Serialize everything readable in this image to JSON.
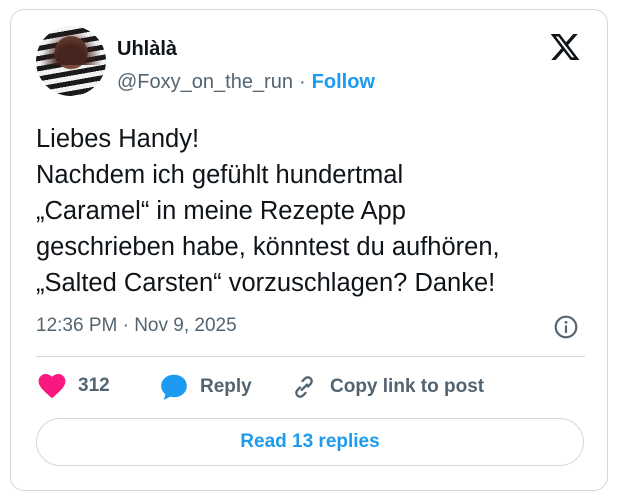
{
  "author": {
    "display_name": "Uhlàlà",
    "handle": "@Foxy_on_the_run",
    "separator": "·",
    "follow_label": "Follow"
  },
  "tweet": {
    "lines": [
      "Liebes Handy!",
      "Nachdem ich gefühlt hundertmal",
      "„Caramel“ in meine Rezepte App",
      "geschrieben habe, könntest du aufhören,",
      "„Salted Carsten“ vorzuschlagen? Danke!"
    ],
    "timestamp": "12:36 PM · Nov 9, 2025"
  },
  "actions": {
    "like_count": "312",
    "reply_label": "Reply",
    "copy_link_label": "Copy link to post"
  },
  "read_replies_label": "Read 13 replies",
  "icons": {
    "logo": "x-logo-icon",
    "info": "info-icon",
    "like": "heart-icon",
    "reply": "speech-bubble-icon",
    "copy": "link-icon"
  },
  "colors": {
    "accent": "#1d9bf0",
    "like": "#f91880",
    "text": "#0f1419",
    "muted": "#536471",
    "border": "#cfd9de"
  }
}
